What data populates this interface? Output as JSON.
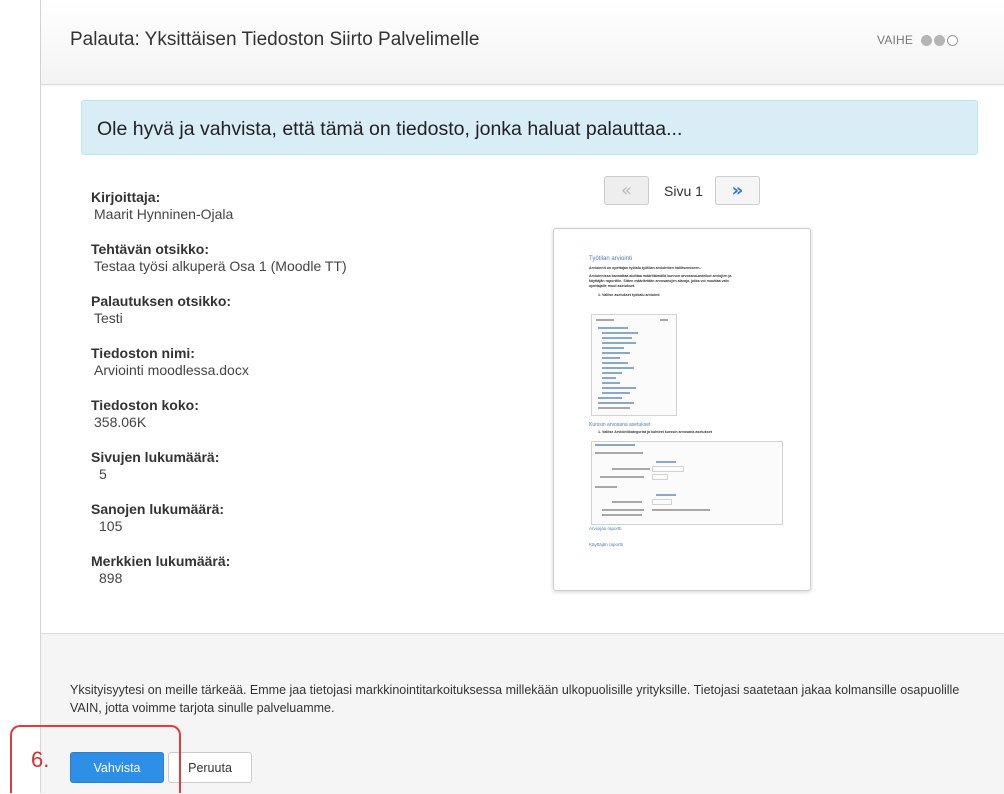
{
  "dialog": {
    "title": "Palauta: Yksittäisen Tiedoston Siirto Palvelimelle",
    "step": {
      "label": "VAIHE",
      "total": 3,
      "completed": 2
    }
  },
  "confirmation": "Ole hyvä ja vahvista, että tämä on tiedosto, jonka haluat palauttaa...",
  "details": [
    {
      "label": "Kirjoittaja:",
      "value": "Maarit Hynninen-Ojala"
    },
    {
      "label": "Tehtävän otsikko:",
      "value": "Testaa työsi alkuperä Osa 1 (Moodle TT)"
    },
    {
      "label": "Palautuksen otsikko:",
      "value": "Testi"
    },
    {
      "label": "Tiedoston nimi:",
      "value": "Arviointi moodlessa.docx"
    },
    {
      "label": "Tiedoston koko:",
      "value": "358.06K"
    },
    {
      "label": "Sivujen lukumäärä:",
      "value": "5"
    },
    {
      "label": "Sanojen lukumäärä:",
      "value": "105"
    },
    {
      "label": "Merkkien lukumäärä:",
      "value": "898"
    }
  ],
  "pager": {
    "prev_icon": "«",
    "label": "Sivu 1",
    "next_icon": "»"
  },
  "preview": {
    "heading": "Työtilan arviointi",
    "intro_1": "Arvioinnit on opettajan työtalu työtilan arviointien hallitsemiseen.",
    "intro_2": "Arvioinnissa kannattaa aloittaa määrittämällä kunnon arvosana-asteikot arviojien ja",
    "intro_3": "käyttäjän raporttiin. Sitten määritetään arvosanojen alaraja, jotka voi muuttaa vain",
    "intro_4": "opettajalle muut asetukset.",
    "step_1": "1.   Valitse asetukset työkalu arviointi",
    "heading_2": "Kurssin arvosana asetukset",
    "step_2": "1.   Valitse Arviointikategoriat ja kohteet kurssin arvosana asetukset",
    "link_1": "Arvioijan raportti",
    "link_2": "Käyttäjän raportti"
  },
  "privacy_text": "Yksityisyytesi on meille tärkeää. Emme jaa tietojasi markkinointitarkoituksessa millekään ulkopuolisille yrityksille. Tietojasi saatetaan jakaa kolmansille osapuolille VAIN, jotta voimme tarjota sinulle palveluamme.",
  "buttons": {
    "confirm": "Vahvista",
    "cancel": "Peruuta"
  },
  "annotation": {
    "number": "6.",
    "color": "#e23b3b"
  },
  "colors": {
    "accent": "#2e8fe6",
    "banner": "#d9edf7",
    "link": "#2a7ad4"
  }
}
